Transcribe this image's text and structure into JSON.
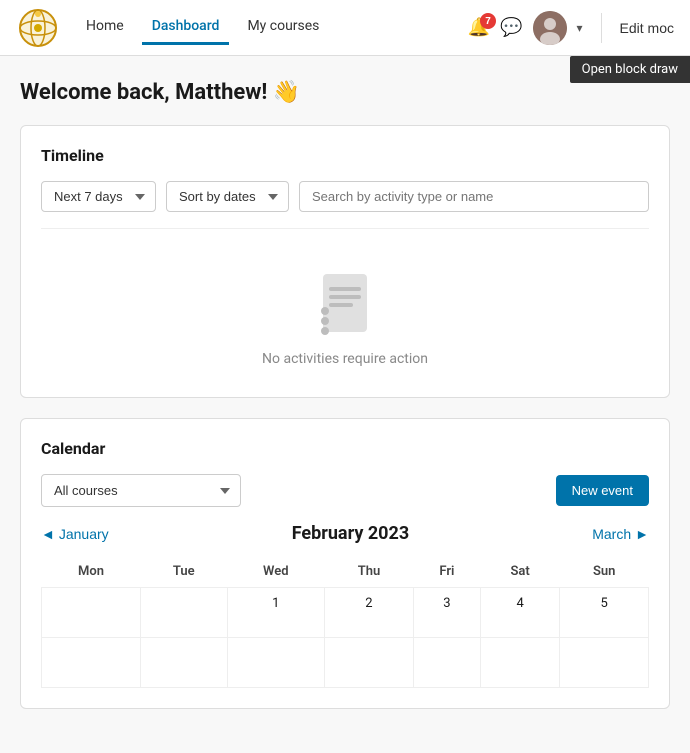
{
  "nav": {
    "links": [
      {
        "label": "Home",
        "active": false
      },
      {
        "label": "Dashboard",
        "active": true
      },
      {
        "label": "My courses",
        "active": false
      }
    ],
    "notification_count": "7",
    "edit_label": "Edit moc"
  },
  "block_drawer": {
    "label": "Open block draw"
  },
  "welcome": {
    "heading": "Welcome back, Matthew! 👋"
  },
  "timeline": {
    "title": "Timeline",
    "filter_days_label": "Next 7 days",
    "filter_sort_label": "Sort by dates",
    "search_placeholder": "Search by activity type or name",
    "empty_message": "No activities require action"
  },
  "calendar": {
    "title": "Calendar",
    "courses_label": "All courses",
    "new_event_label": "New event",
    "prev_month": "January",
    "next_month": "March",
    "current_month_year": "February 2023",
    "weekdays": [
      "Mon",
      "Tue",
      "Wed",
      "Thu",
      "Fri",
      "Sat",
      "Sun"
    ],
    "rows": [
      [
        "",
        "",
        "1",
        "2",
        "3",
        "4",
        "5"
      ],
      [
        "",
        "",
        "",
        "",
        "",
        "",
        ""
      ]
    ]
  }
}
